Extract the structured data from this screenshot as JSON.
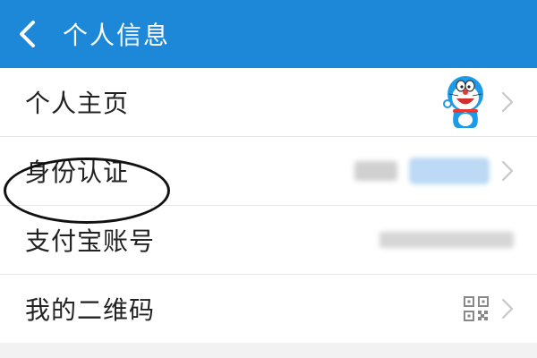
{
  "header": {
    "title": "个人信息"
  },
  "rows": [
    {
      "label": "个人主页",
      "icon": "doraemon-avatar"
    },
    {
      "label": "身份认证"
    },
    {
      "label": "支付宝账号"
    },
    {
      "label": "我的二维码",
      "icon": "qr-code-icon"
    }
  ],
  "colors": {
    "header_bg": "#1e88d8",
    "annotation": "#111111",
    "chevron": "#c7c7c7"
  }
}
